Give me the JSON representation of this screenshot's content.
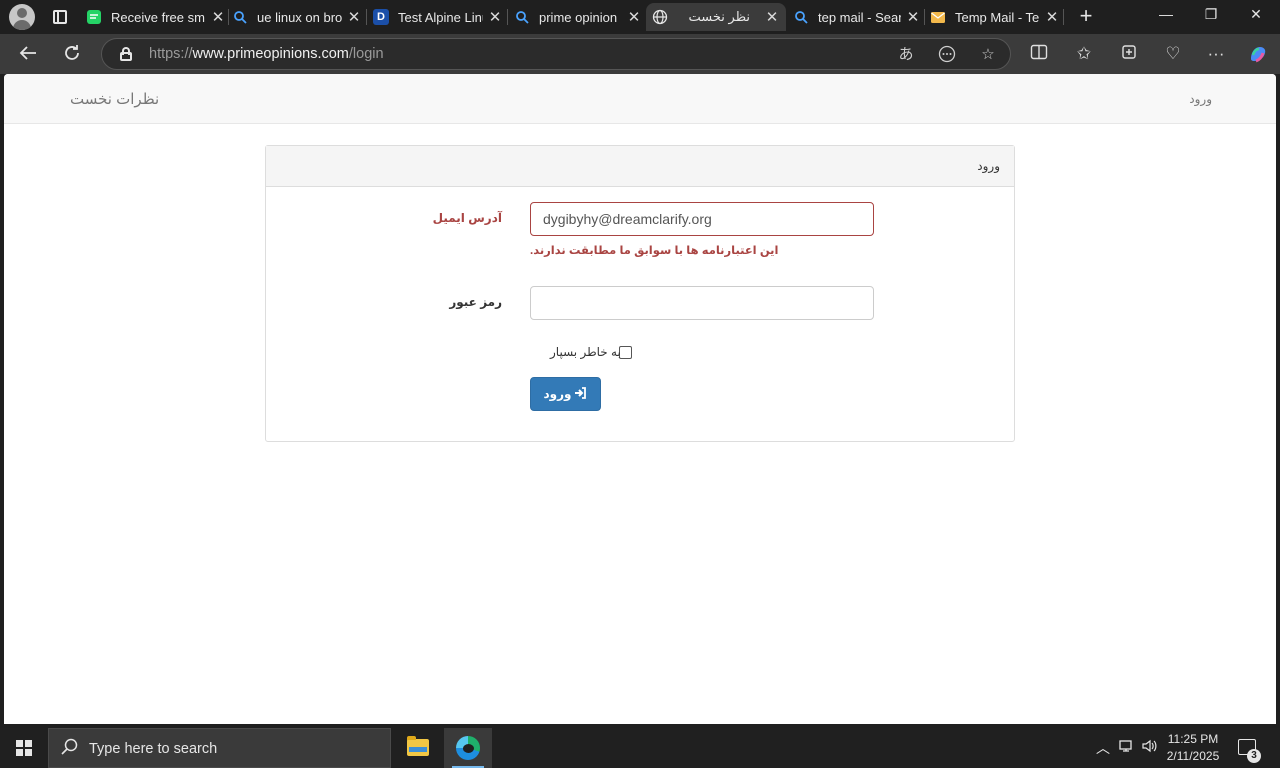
{
  "browser": {
    "tabs": [
      {
        "title": "Receive free sm",
        "favicon": "chat-icon",
        "color": "#25d366"
      },
      {
        "title": "ue linux on bro",
        "favicon": "search-icon",
        "color": "#4aa3ff"
      },
      {
        "title": "Test Alpine Linu",
        "favicon": "D",
        "color": "#1b4fa8"
      },
      {
        "title": "prime opinion",
        "favicon": "search-icon",
        "color": "#4aa3ff"
      },
      {
        "title": "نظر نخست",
        "favicon": "globe-icon",
        "color": "#e6e6e6",
        "active": true
      },
      {
        "title": "tep mail - Sear",
        "favicon": "search-icon",
        "color": "#4aa3ff"
      },
      {
        "title": "Temp Mail - Te",
        "favicon": "envelope-icon",
        "color": "#f2b84b"
      }
    ],
    "url_prefix": "https://",
    "url_host": "www.primeopinions.com",
    "url_path": "/login"
  },
  "page": {
    "brand": "نظرات نخست",
    "nav_login": "ورود",
    "panel_title": "ورود",
    "email_label": "آدرس ایمیل",
    "email_value": "dygibyhy@dreamclarify.org",
    "email_error": "این اعتبارنامه ها با سوابق ما مطابقت ندارند.",
    "password_label": "رمز عبور",
    "remember_label": "به خاطر بسپار",
    "login_button": "ورود"
  },
  "taskbar": {
    "search_placeholder": "Type here to search",
    "time": "11:25 PM",
    "date": "2/11/2025",
    "notification_count": "3"
  },
  "colors": {
    "error": "#a94442",
    "primary_button": "#337ab7"
  }
}
